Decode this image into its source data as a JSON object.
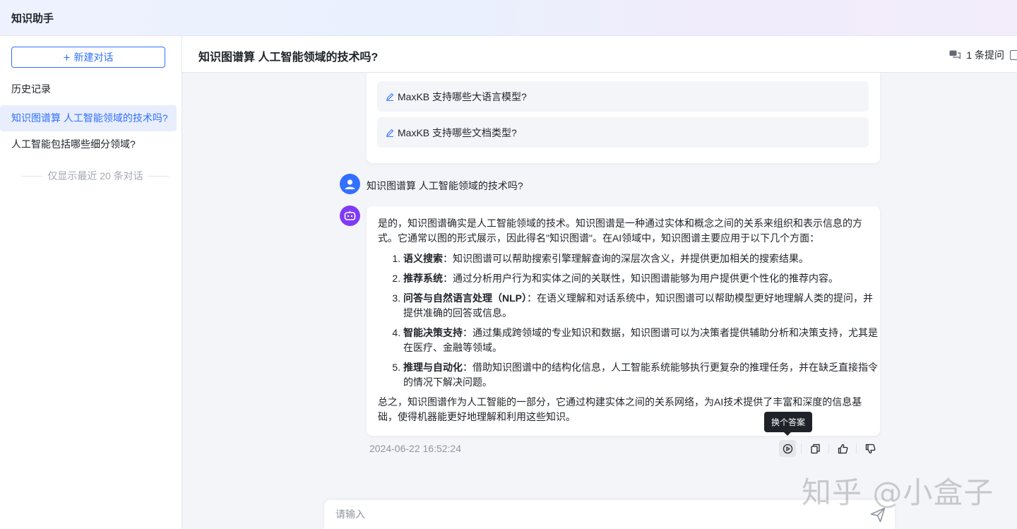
{
  "app": {
    "title": "知识助手"
  },
  "sidebar": {
    "new_chat_label": "新建对话",
    "history_title": "历史记录",
    "items": [
      {
        "label": "知识图谱算 人工智能领域的技术吗?",
        "active": true
      },
      {
        "label": "人工智能包括哪些细分领域?",
        "active": false
      }
    ],
    "note": "仅显示最近 20 条对话"
  },
  "header": {
    "title": "知识图谱算 人工智能领域的技术吗?",
    "question_count": "1 条提问"
  },
  "welcome": {
    "suggestions": [
      "MaxKB 支持哪些大语言模型?",
      "MaxKB 支持哪些文档类型?"
    ]
  },
  "conversation": {
    "user_message": "知识图谱算 人工智能领域的技术吗?",
    "answer": {
      "intro": "是的，知识图谱确实是人工智能领域的技术。知识图谱是一种通过实体和概念之间的关系来组织和表示信息的方式。它通常以图的形式展示，因此得名\"知识图谱\"。在AI领域中，知识图谱主要应用于以下几个方面：",
      "points": [
        {
          "title": "语义搜索",
          "text": "：知识图谱可以帮助搜索引擎理解查询的深层次含义，并提供更加相关的搜索结果。"
        },
        {
          "title": "推荐系统",
          "text": "：通过分析用户行为和实体之间的关联性，知识图谱能够为用户提供更个性化的推荐内容。"
        },
        {
          "title": "问答与自然语言处理（NLP）",
          "text": "：在语义理解和对话系统中，知识图谱可以帮助模型更好地理解人类的提问，并提供准确的回答或信息。"
        },
        {
          "title": "智能决策支持",
          "text": "：通过集成跨领域的专业知识和数据，知识图谱可以为决策者提供辅助分析和决策支持，尤其是在医疗、金融等领域。"
        },
        {
          "title": "推理与自动化",
          "text": "：借助知识图谱中的结构化信息，人工智能系统能够执行更复杂的推理任务，并在缺乏直接指令的情况下解决问题。"
        }
      ],
      "outro": "总之，知识图谱作为人工智能的一部分，它通过构建实体之间的关系网络，为AI技术提供了丰富和深度的信息基础，使得机器能更好地理解和利用这些知识。"
    },
    "timestamp": "2024-06-22 16:52:24",
    "tooltip": "换个答案",
    "action_icons": [
      "regenerate-icon",
      "copy-icon",
      "thumbs-up-icon",
      "thumbs-down-icon"
    ]
  },
  "input": {
    "placeholder": "请输入"
  },
  "watermark": "知乎 @小盒子",
  "colors": {
    "accent": "#3370ff",
    "bot_avatar": "#7f3bf5",
    "active_bg": "#e8eefc"
  }
}
